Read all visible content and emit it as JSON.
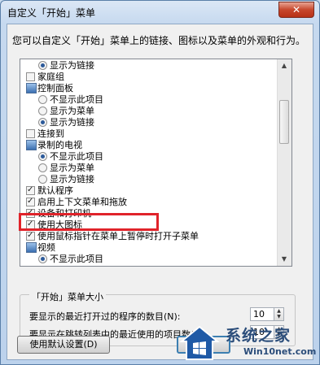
{
  "window": {
    "title": "自定义「开始」菜单",
    "close_glyph": "✕"
  },
  "description": "您可以自定义「开始」菜单上的链接、图标以及菜单的外观和行为。",
  "list_items": [
    {
      "kind": "radio",
      "checked": true,
      "indent": 1,
      "label": "显示为链接"
    },
    {
      "kind": "check",
      "checked": false,
      "indent": 0,
      "label": "家庭组"
    },
    {
      "kind": "icon",
      "indent": 0,
      "label": "控制面板"
    },
    {
      "kind": "radio",
      "checked": false,
      "indent": 1,
      "label": "不显示此项目"
    },
    {
      "kind": "radio",
      "checked": false,
      "indent": 1,
      "label": "显示为菜单"
    },
    {
      "kind": "radio",
      "checked": true,
      "indent": 1,
      "label": "显示为链接"
    },
    {
      "kind": "check",
      "checked": false,
      "indent": 0,
      "label": "连接到"
    },
    {
      "kind": "icon",
      "indent": 0,
      "label": "录制的电视"
    },
    {
      "kind": "radio",
      "checked": true,
      "indent": 1,
      "label": "不显示此项目"
    },
    {
      "kind": "radio",
      "checked": false,
      "indent": 1,
      "label": "显示为菜单"
    },
    {
      "kind": "radio",
      "checked": false,
      "indent": 1,
      "label": "显示为链接"
    },
    {
      "kind": "check",
      "checked": true,
      "indent": 0,
      "label": "默认程序"
    },
    {
      "kind": "check",
      "checked": true,
      "indent": 0,
      "label": "启用上下文菜单和拖放"
    },
    {
      "kind": "check",
      "checked": true,
      "indent": 0,
      "label": "设备和打印机"
    },
    {
      "kind": "check",
      "checked": true,
      "indent": 0,
      "label": "使用大图标"
    },
    {
      "kind": "check",
      "checked": true,
      "indent": 0,
      "label": "使用鼠标指针在菜单上暂停时打开子菜单"
    },
    {
      "kind": "icon",
      "indent": 0,
      "label": "视频"
    },
    {
      "kind": "radio",
      "checked": true,
      "indent": 1,
      "label": "不显示此项目"
    }
  ],
  "size_group": {
    "title": "「开始」菜单大小",
    "recent_programs_label": "要显示的最近打开过的程序的数目(N):",
    "recent_programs_value": "10",
    "jump_list_label": "要显示在跳转列表中的最近使用的项目数(J):",
    "jump_list_value": "10"
  },
  "buttons": {
    "defaults": "使用默认设置(D)",
    "ok": "确定"
  },
  "watermark": {
    "text": "系统之家",
    "site": "Win10net.com"
  },
  "colors": {
    "highlight": "#e0232a",
    "close_button": "#c7472c"
  }
}
